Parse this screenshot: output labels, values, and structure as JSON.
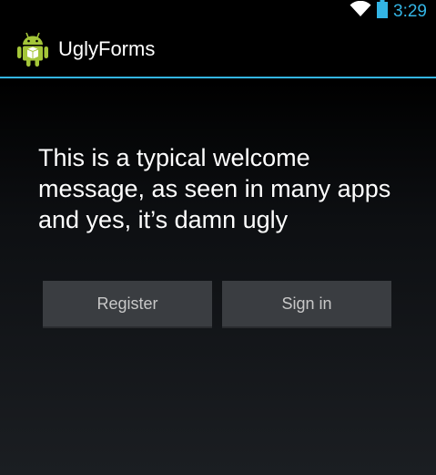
{
  "status_bar": {
    "time": "3:29",
    "icons": [
      "wifi-icon",
      "battery-icon"
    ],
    "accent_color": "#33b5e5"
  },
  "action_bar": {
    "app_icon": "android-robot-icon",
    "title": "UglyForms",
    "divider_color": "#33b5e5"
  },
  "main": {
    "welcome_message": "This is a typical welcome message, as seen in many apps and yes, it’s damn ugly",
    "register_label": "Register",
    "signin_label": "Sign in"
  }
}
